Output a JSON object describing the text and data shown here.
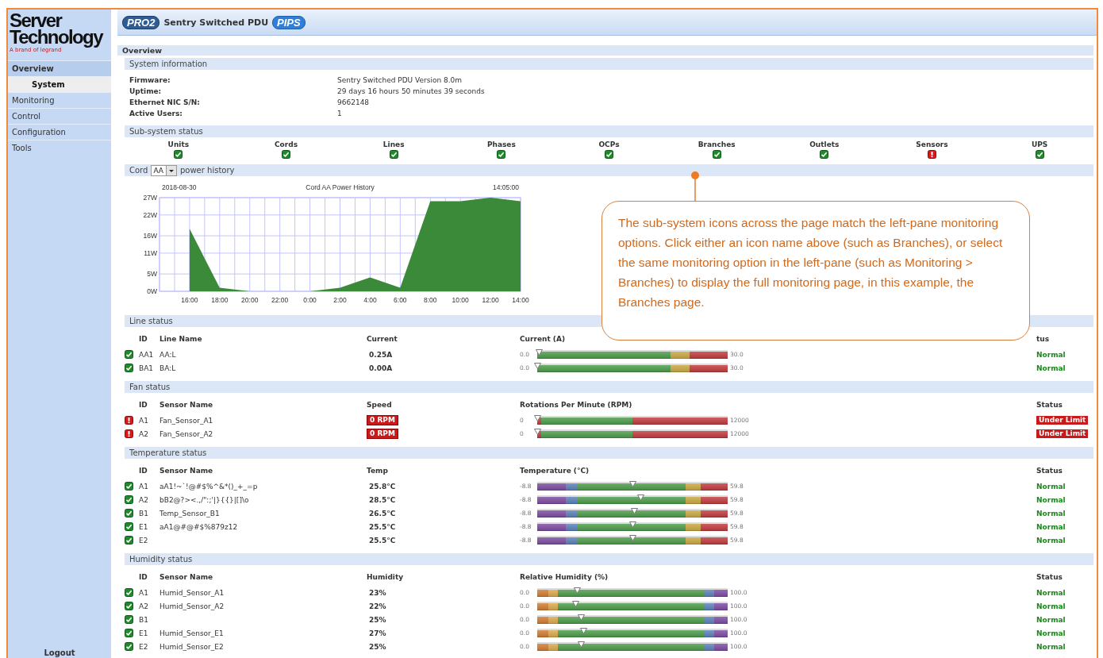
{
  "logo": {
    "lines": [
      "Server",
      "Technology"
    ],
    "tagline": "A brand of legrand"
  },
  "banner": {
    "badge_left": "PRO2",
    "title": "Sentry Switched PDU",
    "badge_right": "PIPS"
  },
  "sidebar": {
    "items": [
      {
        "label": "Overview",
        "kind": "header",
        "selected": false
      },
      {
        "label": "System",
        "kind": "sub",
        "selected": true
      },
      {
        "label": "Monitoring",
        "kind": "item",
        "selected": false
      },
      {
        "label": "Control",
        "kind": "item",
        "selected": false
      },
      {
        "label": "Configuration",
        "kind": "item",
        "selected": false
      },
      {
        "label": "Tools",
        "kind": "item",
        "selected": false
      }
    ],
    "logout": "Logout"
  },
  "page_title": "Overview",
  "system_information": {
    "title": "System information",
    "fields": [
      {
        "label": "Firmware:",
        "value": "Sentry Switched PDU Version 8.0m"
      },
      {
        "label": "Uptime:",
        "value": "29 days 16 hours 50 minutes 39 seconds"
      },
      {
        "label": "Ethernet NIC S/N:",
        "value": "9662148"
      },
      {
        "label": "Active Users:",
        "value": "1"
      }
    ]
  },
  "subsystem_status": {
    "title": "Sub-system status",
    "items": [
      {
        "label": "Units",
        "alarm": false
      },
      {
        "label": "Cords",
        "alarm": false
      },
      {
        "label": "Lines",
        "alarm": false
      },
      {
        "label": "Phases",
        "alarm": false
      },
      {
        "label": "OCPs",
        "alarm": false
      },
      {
        "label": "Branches",
        "alarm": false
      },
      {
        "label": "Outlets",
        "alarm": false
      },
      {
        "label": "Sensors",
        "alarm": true
      },
      {
        "label": "UPS",
        "alarm": false
      }
    ]
  },
  "power_history": {
    "prefix": "Cord",
    "cord": "AA",
    "suffix": "power history",
    "date": "2018-08-30",
    "time": "14:05:00",
    "chart_data": {
      "type": "area",
      "title": "Cord AA Power History",
      "grid": true,
      "ylim": [
        0,
        27
      ],
      "categories": [
        "16:00",
        "18:00",
        "20:00",
        "22:00",
        "0:00",
        "2:00",
        "4:00",
        "6:00",
        "8:00",
        "10:00",
        "12:00",
        "14:00"
      ],
      "yticks": [
        {
          "value": 0,
          "label": "0W"
        },
        {
          "value": 5,
          "label": "5W"
        },
        {
          "value": 11,
          "label": "11W"
        },
        {
          "value": 16,
          "label": "16W"
        },
        {
          "value": 22,
          "label": "22W"
        },
        {
          "value": 27,
          "label": "27W"
        }
      ],
      "series": [
        {
          "color": "#3a8a3a",
          "values": [
            18,
            1,
            0,
            0,
            0,
            1,
            4,
            1,
            26,
            26,
            27,
            26
          ]
        }
      ]
    }
  },
  "callout": {
    "text": "The sub-system icons across the page match the left-pane monitoring options. Click either an icon name above (such as Branches), or select the same monitoring option in the left-pane (such as Monitoring > Branches) to display the full monitoring page, in this example, the Branches page."
  },
  "sections": [
    {
      "title": "Line status",
      "kind": "current",
      "columns": [
        "ID",
        "Line Name",
        "Current",
        "Current (A)",
        "tus"
      ],
      "rows": [
        {
          "alarm": false,
          "id": "AA1",
          "name": "AA:L",
          "value": "0.25A",
          "min": "0.0",
          "max": "30.0",
          "level": 0.01,
          "state": "Normal"
        },
        {
          "alarm": false,
          "id": "BA1",
          "name": "BA:L",
          "value": "0.00A",
          "min": "0.0",
          "max": "30.0",
          "level": 0,
          "state": "Normal"
        }
      ]
    },
    {
      "title": "Fan status",
      "kind": "fan",
      "columns": [
        "ID",
        "Sensor Name",
        "Speed",
        "Rotations Per Minute (RPM)",
        "Status"
      ],
      "rows": [
        {
          "alarm": true,
          "id": "A1",
          "name": "Fan_Sensor_A1",
          "value": "0 RPM",
          "min": "0",
          "max": "12000",
          "level": 0,
          "state": "Under Limit"
        },
        {
          "alarm": true,
          "id": "A2",
          "name": "Fan_Sensor_A2",
          "value": "0 RPM",
          "min": "0",
          "max": "12000",
          "level": 0,
          "state": "Under Limit"
        }
      ]
    },
    {
      "title": "Temperature status",
      "kind": "temperature",
      "columns": [
        "ID",
        "Sensor Name",
        "Temp",
        "Temperature (°C)",
        "Status"
      ],
      "rows": [
        {
          "alarm": false,
          "id": "A1",
          "name": "aA1!~`!@#$%^&*()_+_=p",
          "value": "25.8°C",
          "min": "-8.8",
          "max": "59.8",
          "level": 0.5,
          "state": "Normal"
        },
        {
          "alarm": false,
          "id": "A2",
          "name": "bB2@?><.,/\":;'|}{{}|[]\\o",
          "value": "28.5°C",
          "min": "-8.8",
          "max": "59.8",
          "level": 0.54,
          "state": "Normal"
        },
        {
          "alarm": false,
          "id": "B1",
          "name": "Temp_Sensor_B1",
          "value": "26.5°C",
          "min": "-8.8",
          "max": "59.8",
          "level": 0.51,
          "state": "Normal"
        },
        {
          "alarm": false,
          "id": "E1",
          "name": "aA1@#@#$%879z12",
          "value": "25.5°C",
          "min": "-8.8",
          "max": "59.8",
          "level": 0.5,
          "state": "Normal"
        },
        {
          "alarm": false,
          "id": "E2",
          "value": "25.5°C",
          "min": "-8.8",
          "max": "59.8",
          "level": 0.5,
          "state": "Normal"
        }
      ]
    },
    {
      "title": "Humidity status",
      "kind": "humidity",
      "columns": [
        "ID",
        "Sensor Name",
        "Humidity",
        "Relative Humidity (%)",
        "Status"
      ],
      "rows": [
        {
          "alarm": false,
          "id": "A1",
          "name": "Humid_Sensor_A1",
          "value": "23%",
          "min": "0.0",
          "max": "100.0",
          "level": 0.21,
          "state": "Normal"
        },
        {
          "alarm": false,
          "id": "A2",
          "name": "Humid_Sensor_A2",
          "value": "22%",
          "min": "0.0",
          "max": "100.0",
          "level": 0.2,
          "state": "Normal"
        },
        {
          "alarm": false,
          "id": "B1",
          "value": "25%",
          "min": "0.0",
          "max": "100.0",
          "level": 0.23,
          "state": "Normal"
        },
        {
          "alarm": false,
          "id": "E1",
          "name": "Humid_Sensor_E1",
          "value": "27%",
          "min": "0.0",
          "max": "100.0",
          "level": 0.24,
          "state": "Normal"
        },
        {
          "alarm": false,
          "id": "E2",
          "name": "Humid_Sensor_E2",
          "value": "25%",
          "min": "0.0",
          "max": "100.0",
          "level": 0.23,
          "state": "Normal"
        }
      ]
    }
  ]
}
